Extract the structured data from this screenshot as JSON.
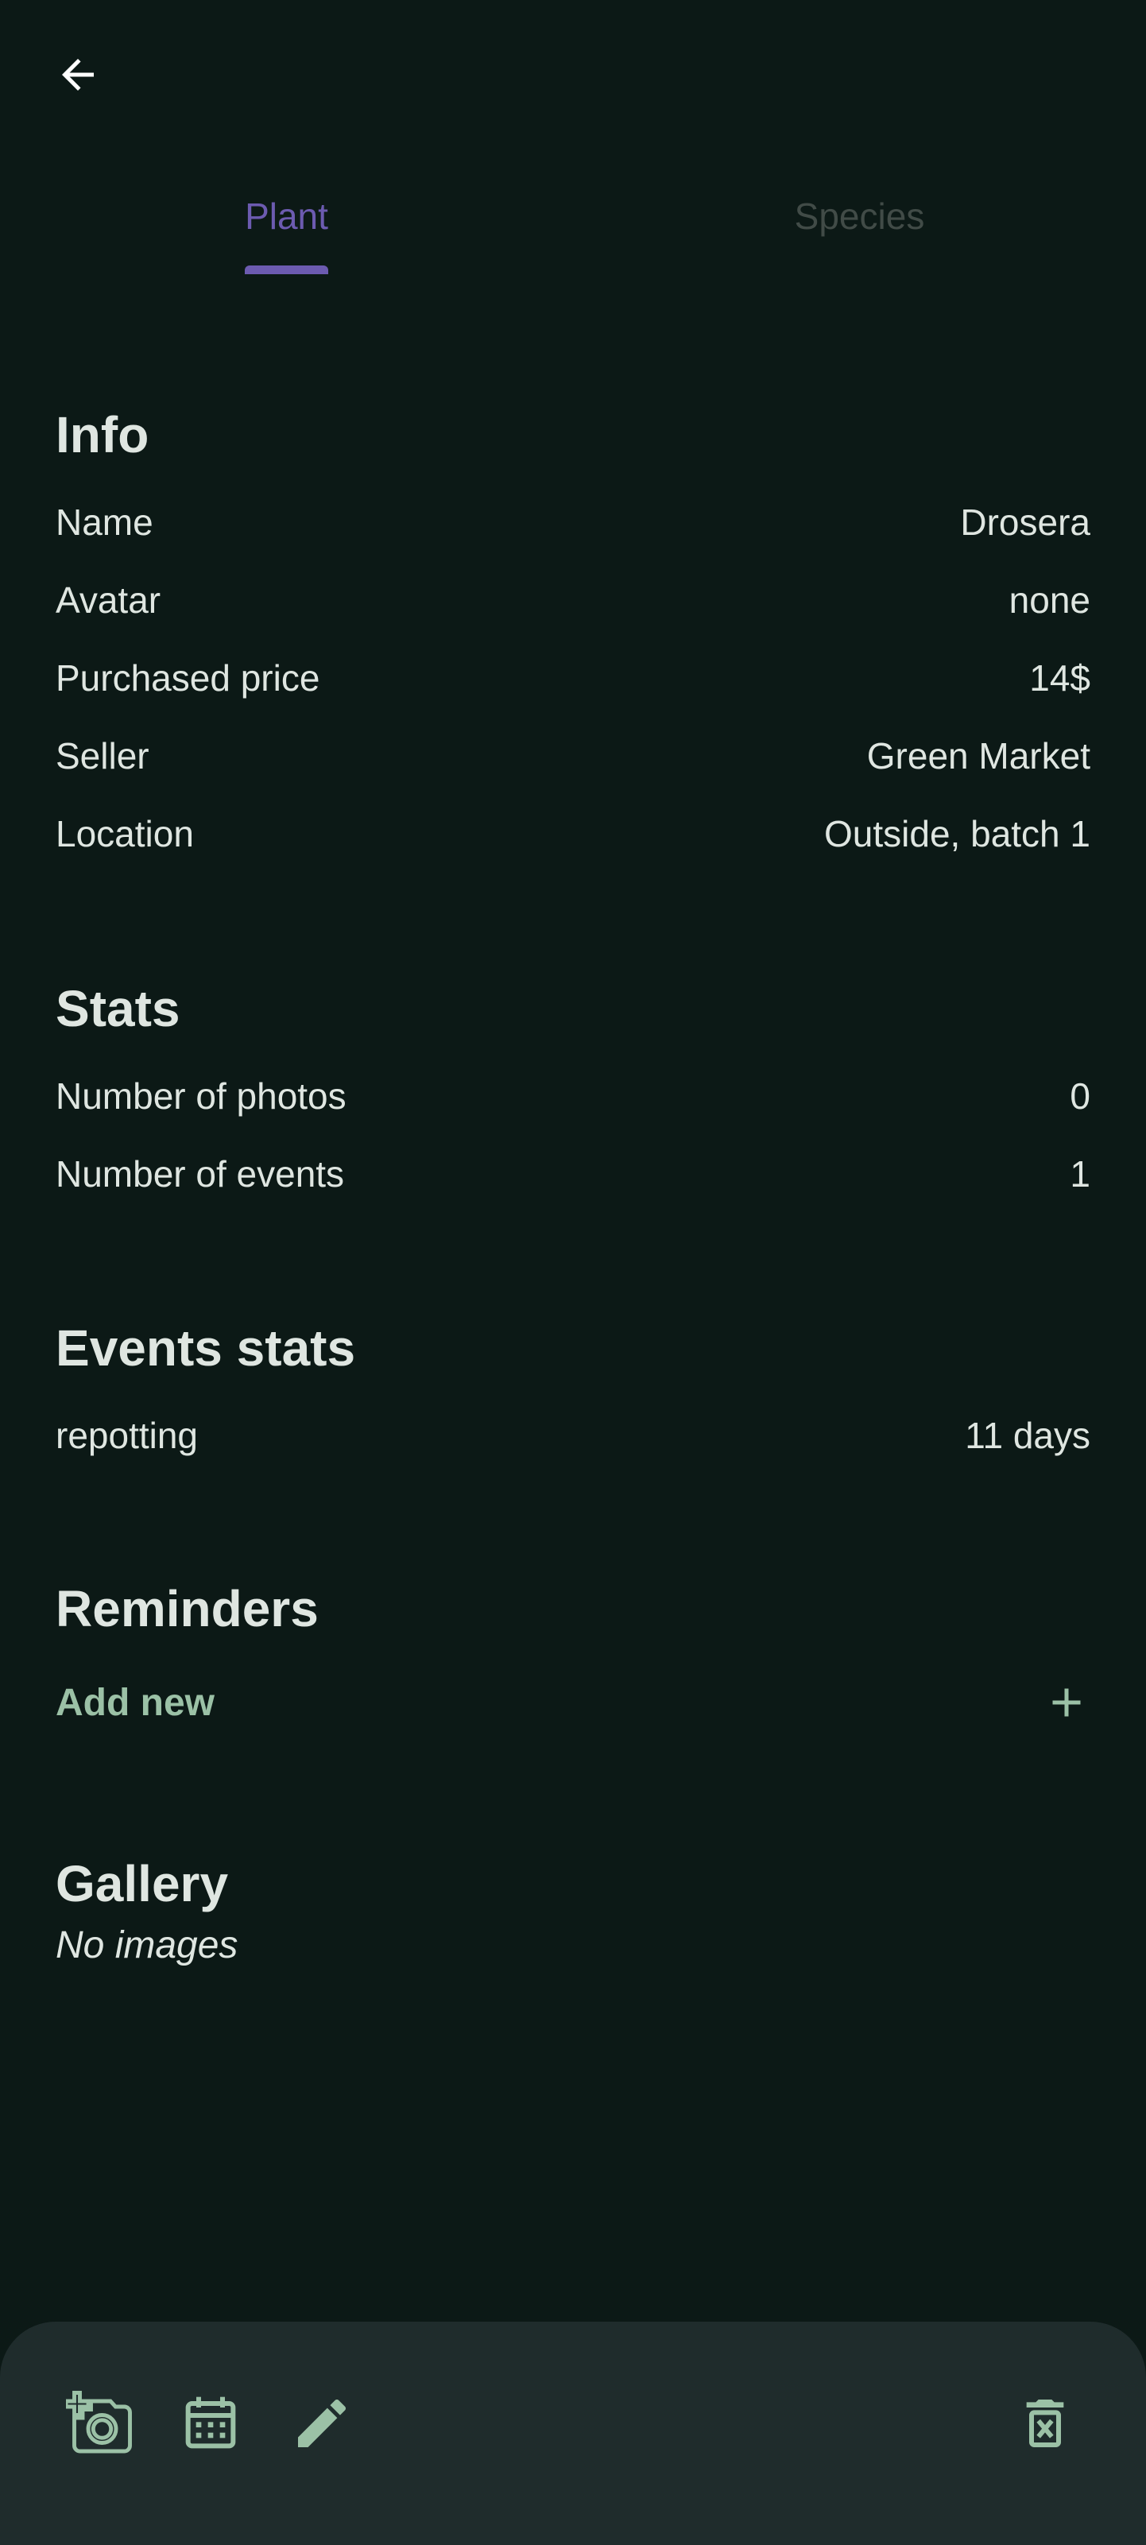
{
  "header": {
    "back_icon": "arrow-left-icon"
  },
  "tabs": [
    {
      "label": "Plant",
      "active": true
    },
    {
      "label": "Species",
      "active": false
    }
  ],
  "info": {
    "title": "Info",
    "rows": [
      {
        "label": "Name",
        "value": "Drosera"
      },
      {
        "label": "Avatar",
        "value": "none"
      },
      {
        "label": "Purchased price",
        "value": "14$"
      },
      {
        "label": "Seller",
        "value": "Green Market"
      },
      {
        "label": "Location",
        "value": "Outside, batch 1"
      }
    ]
  },
  "stats": {
    "title": "Stats",
    "rows": [
      {
        "label": "Number of photos",
        "value": "0"
      },
      {
        "label": "Number of events",
        "value": "1"
      }
    ]
  },
  "events_stats": {
    "title": "Events stats",
    "rows": [
      {
        "label": "repotting",
        "value": "11 days"
      }
    ]
  },
  "reminders": {
    "title": "Reminders",
    "add_label": "Add new",
    "add_icon": "plus-icon"
  },
  "gallery": {
    "title": "Gallery",
    "empty_text": "No images"
  },
  "bottom_bar": {
    "actions": [
      "add-photo-icon",
      "calendar-icon",
      "edit-pencil-icon",
      "delete-icon"
    ]
  },
  "colors": {
    "background": "#0c1916",
    "accent": "#6c5bb0",
    "secondary_accent": "#9bc1a6",
    "bar_background": "#1f2c2c",
    "text": "#dfe6e1"
  }
}
